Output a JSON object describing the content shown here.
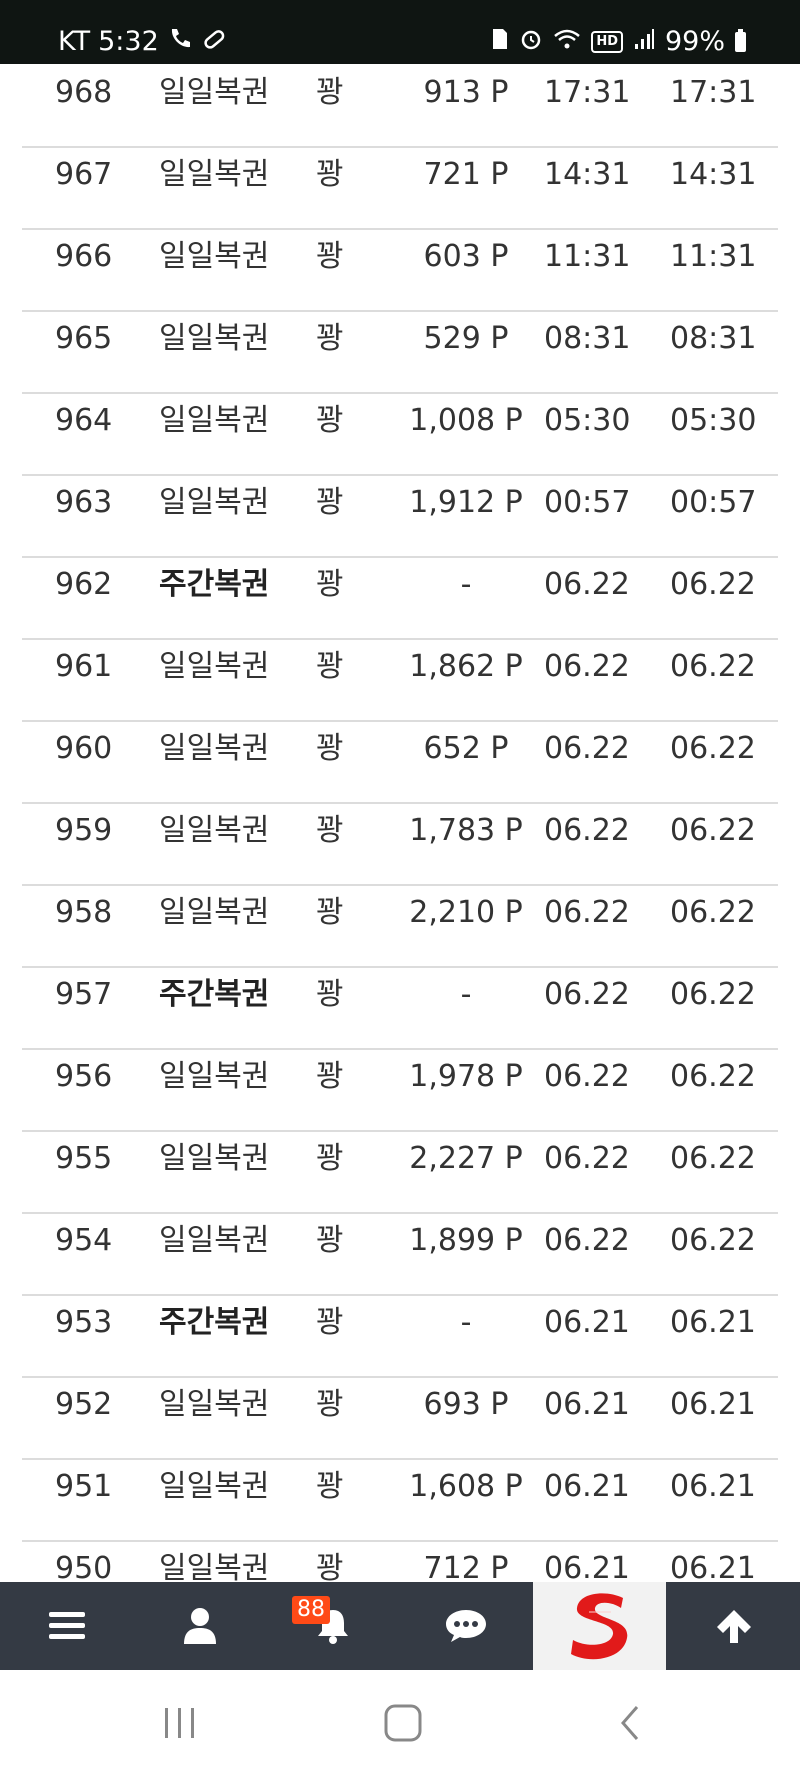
{
  "status_bar": {
    "carrier": "KT",
    "time": "5:32",
    "battery": "99%",
    "icons": [
      "call-icon",
      "who-icon",
      "pill-icon",
      "sim-icon",
      "alarm-icon",
      "wifi-icon",
      "hd-icon",
      "signal-icon",
      "battery-icon"
    ],
    "hd_label": "HD"
  },
  "table": {
    "rows": [
      {
        "num": "968",
        "type": "일일복권",
        "weekly": false,
        "result": "꽝",
        "points": "913 P",
        "t1": "17:31",
        "t2": "17:31"
      },
      {
        "num": "967",
        "type": "일일복권",
        "weekly": false,
        "result": "꽝",
        "points": "721 P",
        "t1": "14:31",
        "t2": "14:31"
      },
      {
        "num": "966",
        "type": "일일복권",
        "weekly": false,
        "result": "꽝",
        "points": "603 P",
        "t1": "11:31",
        "t2": "11:31"
      },
      {
        "num": "965",
        "type": "일일복권",
        "weekly": false,
        "result": "꽝",
        "points": "529 P",
        "t1": "08:31",
        "t2": "08:31"
      },
      {
        "num": "964",
        "type": "일일복권",
        "weekly": false,
        "result": "꽝",
        "points": "1,008 P",
        "t1": "05:30",
        "t2": "05:30"
      },
      {
        "num": "963",
        "type": "일일복권",
        "weekly": false,
        "result": "꽝",
        "points": "1,912 P",
        "t1": "00:57",
        "t2": "00:57"
      },
      {
        "num": "962",
        "type": "주간복권",
        "weekly": true,
        "result": "꽝",
        "points": "-",
        "t1": "06.22",
        "t2": "06.22"
      },
      {
        "num": "961",
        "type": "일일복권",
        "weekly": false,
        "result": "꽝",
        "points": "1,862 P",
        "t1": "06.22",
        "t2": "06.22"
      },
      {
        "num": "960",
        "type": "일일복권",
        "weekly": false,
        "result": "꽝",
        "points": "652 P",
        "t1": "06.22",
        "t2": "06.22"
      },
      {
        "num": "959",
        "type": "일일복권",
        "weekly": false,
        "result": "꽝",
        "points": "1,783 P",
        "t1": "06.22",
        "t2": "06.22"
      },
      {
        "num": "958",
        "type": "일일복권",
        "weekly": false,
        "result": "꽝",
        "points": "2,210 P",
        "t1": "06.22",
        "t2": "06.22"
      },
      {
        "num": "957",
        "type": "주간복권",
        "weekly": true,
        "result": "꽝",
        "points": "-",
        "t1": "06.22",
        "t2": "06.22"
      },
      {
        "num": "956",
        "type": "일일복권",
        "weekly": false,
        "result": "꽝",
        "points": "1,978 P",
        "t1": "06.22",
        "t2": "06.22"
      },
      {
        "num": "955",
        "type": "일일복권",
        "weekly": false,
        "result": "꽝",
        "points": "2,227 P",
        "t1": "06.22",
        "t2": "06.22"
      },
      {
        "num": "954",
        "type": "일일복권",
        "weekly": false,
        "result": "꽝",
        "points": "1,899 P",
        "t1": "06.22",
        "t2": "06.22"
      },
      {
        "num": "953",
        "type": "주간복권",
        "weekly": true,
        "result": "꽝",
        "points": "-",
        "t1": "06.21",
        "t2": "06.21"
      },
      {
        "num": "952",
        "type": "일일복권",
        "weekly": false,
        "result": "꽝",
        "points": "693 P",
        "t1": "06.21",
        "t2": "06.21"
      },
      {
        "num": "951",
        "type": "일일복권",
        "weekly": false,
        "result": "꽝",
        "points": "1,608 P",
        "t1": "06.21",
        "t2": "06.21"
      },
      {
        "num": "950",
        "type": "일일복권",
        "weekly": false,
        "result": "꽝",
        "points": "712 P",
        "t1": "06.21",
        "t2": "06.21"
      }
    ]
  },
  "bottom_nav": {
    "items": [
      {
        "name": "menu",
        "icon": "hamburger-menu-icon"
      },
      {
        "name": "profile",
        "icon": "user-icon"
      },
      {
        "name": "notifications",
        "icon": "bell-icon"
      },
      {
        "name": "chat",
        "icon": "chat-bubble-icon"
      },
      {
        "name": "site-logo",
        "icon": "s-logo-icon"
      },
      {
        "name": "scroll-top",
        "icon": "arrow-up-icon"
      }
    ],
    "notification_count": "88",
    "background": "#343a44",
    "badge_color": "#ff4a17",
    "logo_color": "#e11a1a"
  },
  "android_nav": {
    "buttons": [
      {
        "name": "recent-apps",
        "icon": "recents-icon"
      },
      {
        "name": "home",
        "icon": "home-icon"
      },
      {
        "name": "back",
        "icon": "back-icon"
      }
    ]
  }
}
